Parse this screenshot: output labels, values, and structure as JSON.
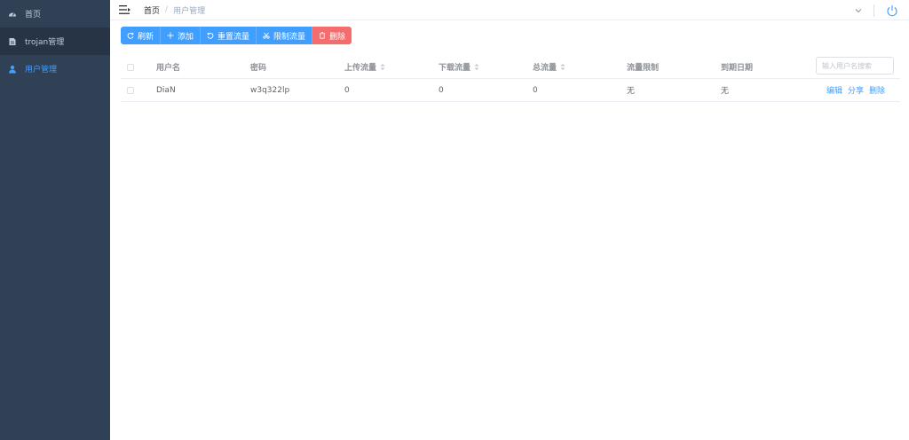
{
  "sidebar": {
    "items": [
      {
        "label": "首页"
      },
      {
        "label": "trojan管理"
      },
      {
        "label": "用户管理"
      }
    ]
  },
  "navbar": {
    "breadcrumb": {
      "home": "首页",
      "separator": "/",
      "current": "用户管理"
    }
  },
  "toolbar": {
    "refresh": "刷新",
    "add": "添加",
    "reset_traffic": "重置流量",
    "limit_traffic": "限制流量",
    "delete": "删除"
  },
  "table": {
    "headers": {
      "username": "用户名",
      "password": "密码",
      "upload": "上传流量",
      "download": "下载流量",
      "total": "总流量",
      "limit": "流量限制",
      "expire": "到期日期"
    },
    "rows": [
      {
        "username": "DiaN",
        "password": "w3q322lp",
        "upload": "0",
        "download": "0",
        "total": "0",
        "limit": "无",
        "expire": "无",
        "actions": {
          "edit": "编辑",
          "share": "分享",
          "delete": "删除"
        }
      }
    ]
  },
  "search": {
    "placeholder": "输入用户名搜索",
    "value": ""
  },
  "colors": {
    "sidebar_bg": "#304156",
    "sidebar_active_bg": "#263445",
    "primary": "#409eff",
    "danger": "#f56c6c"
  }
}
